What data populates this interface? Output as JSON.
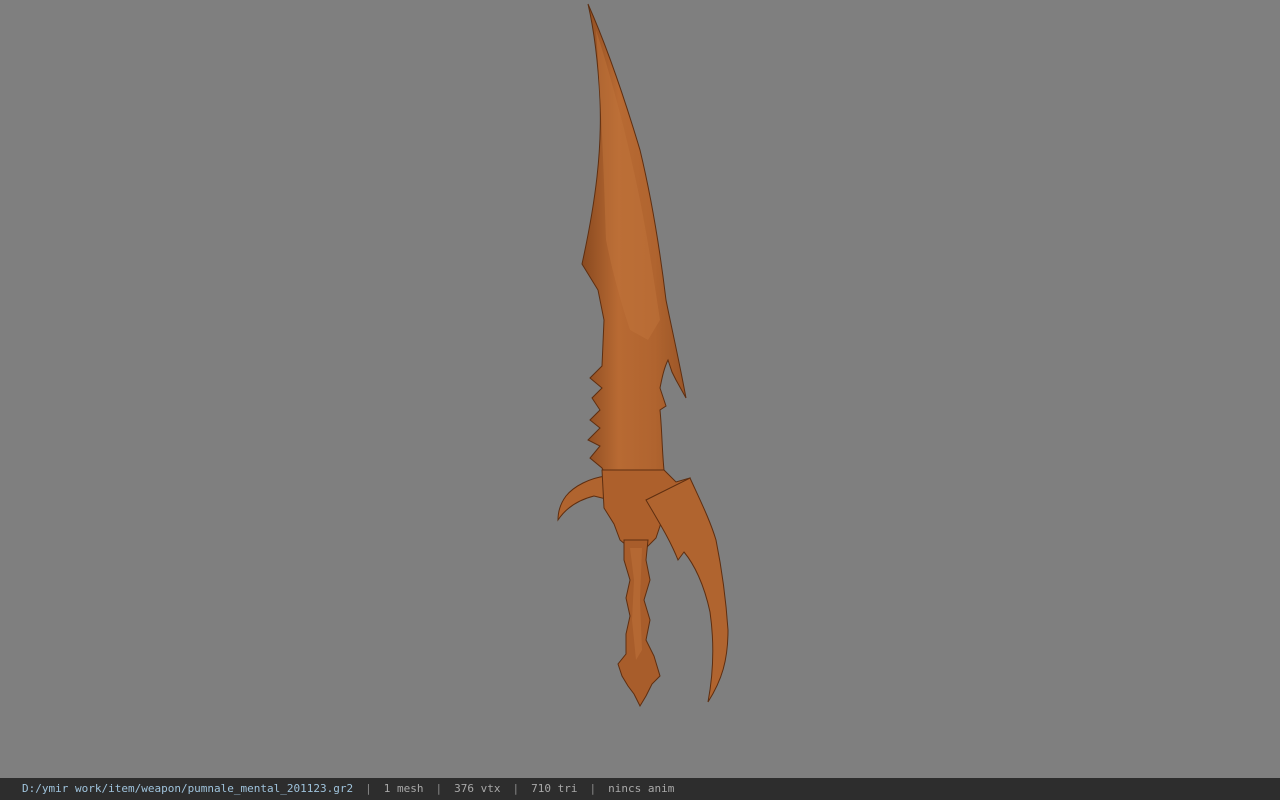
{
  "viewport": {
    "background_color": "#7f7f7f",
    "model": {
      "color": "#b0642f",
      "shadow_color": "#6b3414",
      "highlight_color": "#c97a42"
    }
  },
  "status_bar": {
    "file_path": "D:/ymir work/item/weapon/pumnale_mental_201123.gr2",
    "separator": "|",
    "mesh_count": "1 mesh",
    "vertex_count": "376 vtx",
    "triangle_count": "710 tri",
    "anim_status": "nincs anim"
  }
}
